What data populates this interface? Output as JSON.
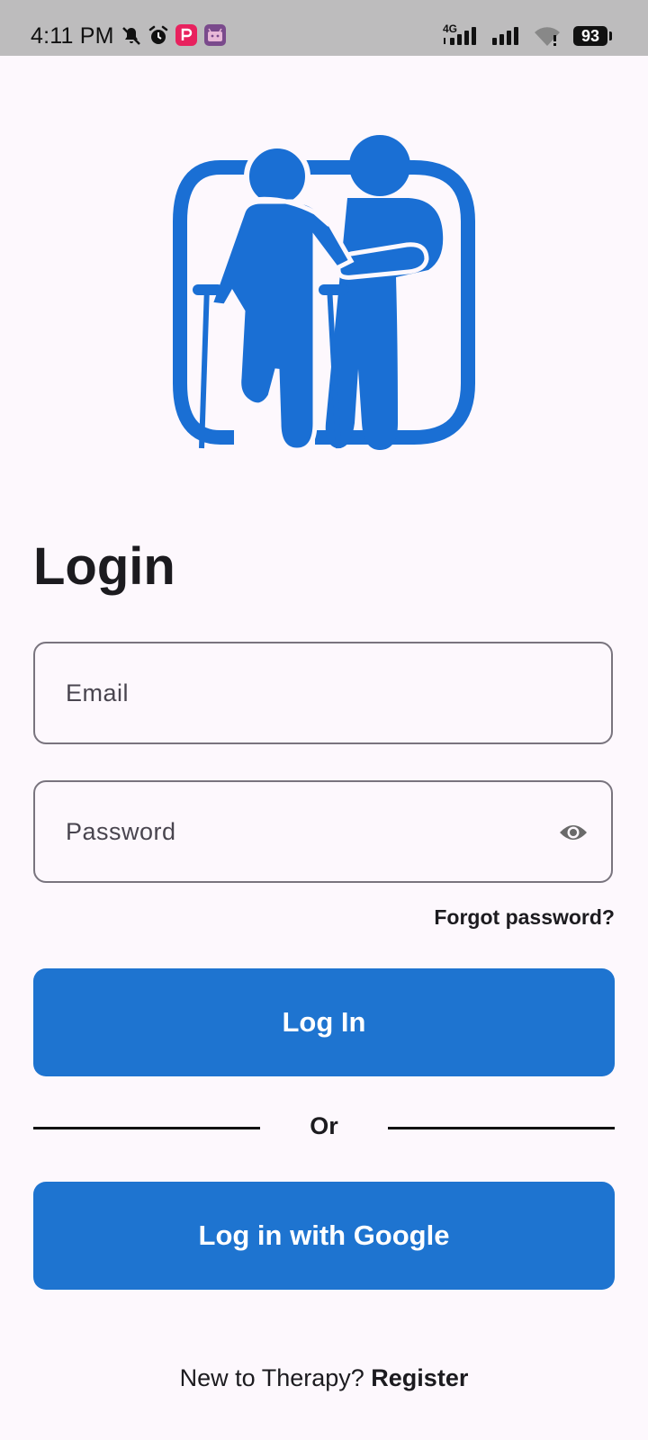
{
  "status_bar": {
    "time": "4:11 PM",
    "network_label": "4G",
    "battery_level": "93",
    "icons": [
      "mute-icon",
      "alarm-icon",
      "app-notification-icon",
      "android-notification-icon",
      "signal-icon",
      "signal-icon-2",
      "wifi-icon",
      "battery-icon"
    ]
  },
  "logo": {
    "icon": "elderly-care-logo-icon",
    "color": "#1a6fd4"
  },
  "login": {
    "title": "Login",
    "email_placeholder": "Email",
    "email_value": "",
    "password_placeholder": "Password",
    "password_value": "",
    "visibility_icon": "eye-icon",
    "forgot_password": "Forgot password?",
    "login_button": "Log In",
    "divider_text": "Or",
    "google_button": "Log in with Google",
    "register_prompt": "New to Therapy?",
    "register_link": "Register"
  },
  "colors": {
    "primary": "#1e74d0",
    "background": "#fdf8fd",
    "status_bar": "#bdbcbd",
    "outline": "#79747e"
  }
}
